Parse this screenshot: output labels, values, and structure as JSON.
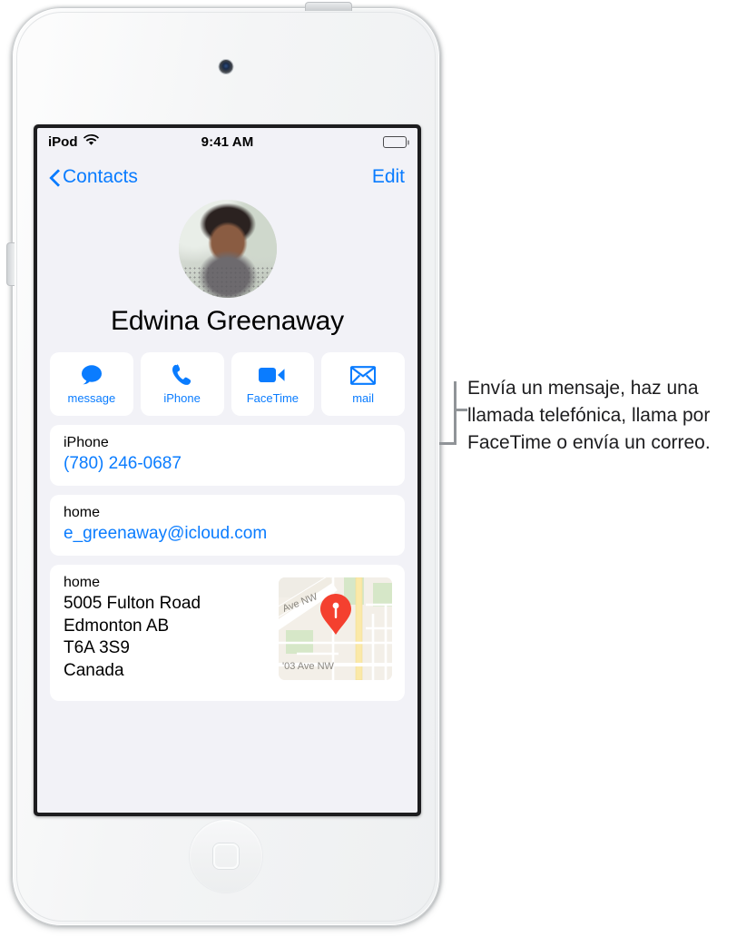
{
  "device": {
    "model_shape": "ipod-touch",
    "camera_icon": "front-camera-icon",
    "home_button_icon": "home-button-icon",
    "power_button": "power-button",
    "volume_button": "volume-button"
  },
  "status_bar": {
    "carrier": "iPod",
    "wifi_icon": "wifi-icon",
    "time": "9:41 AM",
    "battery_icon": "battery-full-icon"
  },
  "nav_bar": {
    "back_icon": "chevron-left-icon",
    "back_label": "Contacts",
    "edit_label": "Edit"
  },
  "contact": {
    "avatar_alt": "contact-photo",
    "name": "Edwina Greenaway"
  },
  "actions": [
    {
      "icon": "message-bubble-icon",
      "label": "message"
    },
    {
      "icon": "phone-handset-icon",
      "label": "iPhone"
    },
    {
      "icon": "video-camera-icon",
      "label": "FaceTime"
    },
    {
      "icon": "envelope-icon",
      "label": "mail"
    }
  ],
  "fields": [
    {
      "label": "iPhone",
      "value": "(780) 246-0687",
      "type": "phone"
    },
    {
      "label": "home",
      "value": "e_greenaway@icloud.com",
      "type": "email"
    }
  ],
  "address": {
    "label": "home",
    "lines": [
      "5005 Fulton Road",
      "Edmonton AB",
      "T6A 3S9",
      "Canada"
    ],
    "line1": "5005 Fulton Road",
    "line2": "Edmonton AB",
    "line3": "T6A 3S9",
    "line4": "Canada",
    "map": {
      "icon": "map-pin-icon",
      "street_label_1": "Ave NW",
      "street_label_2": "'03 Ave NW",
      "pin_color": "#f4402f"
    }
  },
  "callout": {
    "text": "Envía un mensaje, haz una llamada telefónica, llama por FaceTime o envía un correo."
  },
  "colors": {
    "accent_blue": "#0a7cff",
    "screen_background": "#f2f2f7",
    "card_background": "#ffffff",
    "page_background": "#ffffff",
    "pin_red": "#f4402f"
  }
}
